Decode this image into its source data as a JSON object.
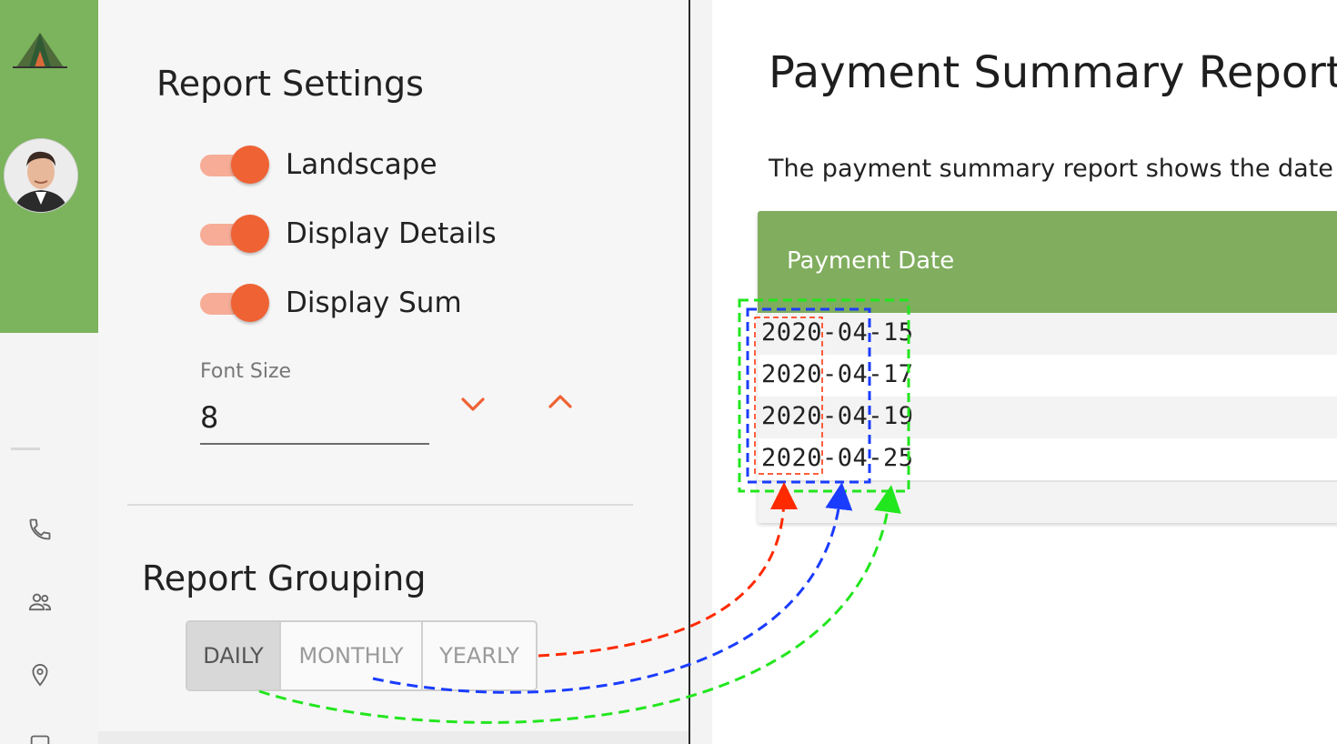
{
  "settings": {
    "title": "Report Settings",
    "toggles": [
      {
        "label": "Landscape",
        "on": true
      },
      {
        "label": "Display Details",
        "on": true
      },
      {
        "label": "Display Sum",
        "on": true
      }
    ],
    "font_size": {
      "label": "Font Size",
      "value": "8"
    },
    "grouping": {
      "title": "Report Grouping",
      "options": [
        "DAILY",
        "MONTHLY",
        "YEARLY"
      ],
      "selected": "DAILY"
    }
  },
  "report": {
    "title": "Payment Summary Report",
    "description": "The payment summary report shows the date or",
    "column_header": "Payment Date",
    "rows": [
      "2020-04-15",
      "2020-04-17",
      "2020-04-19",
      "2020-04-25"
    ]
  },
  "colors": {
    "sidebar_green": "#7cb35d",
    "table_header_green": "#80ad5e",
    "accent_orange": "#ef6234",
    "annotation_daily": "#ff2a00",
    "annotation_monthly": "#1a3cff",
    "annotation_yearly": "#22e61e"
  },
  "icons": [
    "logo-tent-icon",
    "phone-icon",
    "people-icon",
    "location-pin-icon",
    "chevron-down-icon",
    "chevron-up-icon"
  ]
}
